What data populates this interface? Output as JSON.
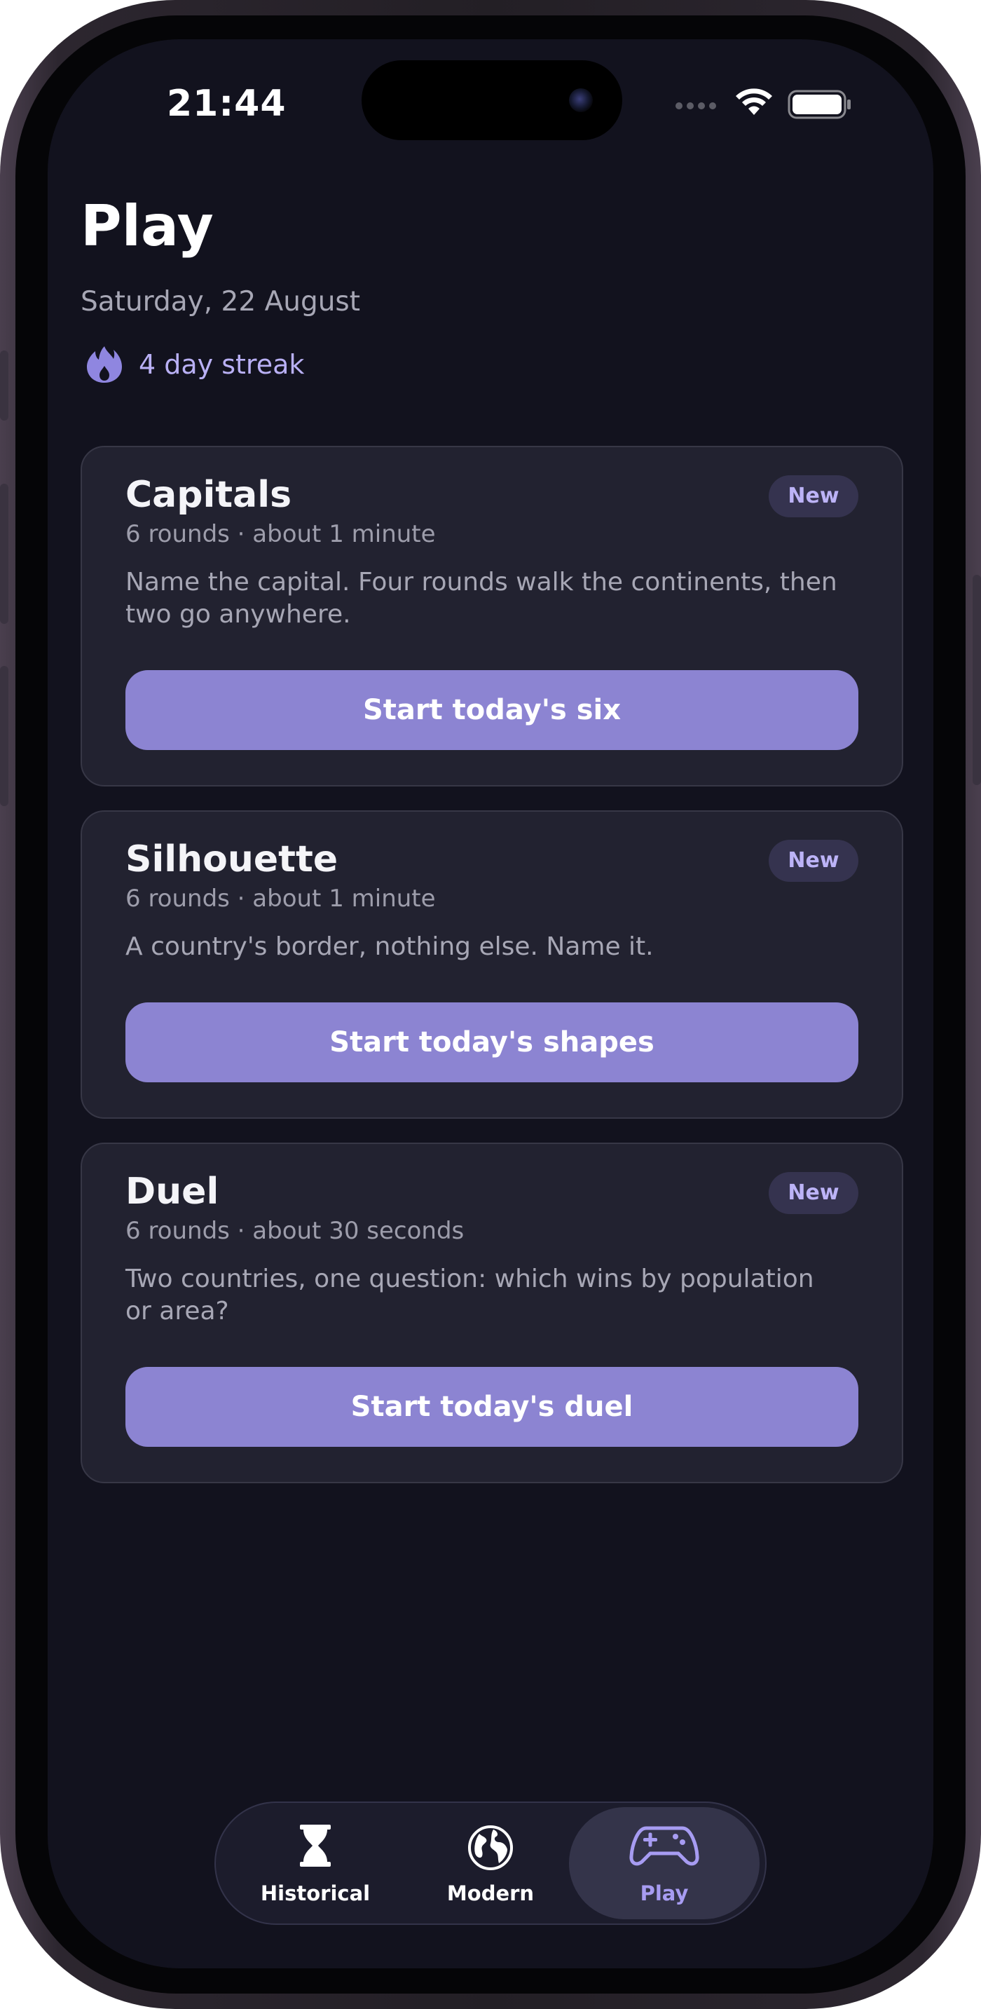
{
  "status_bar": {
    "time": "21:44"
  },
  "header": {
    "title": "Play",
    "date": "Saturday, 22 August",
    "streak": "4 day streak"
  },
  "cards": [
    {
      "title": "Capitals",
      "meta": "6 rounds · about 1 minute",
      "badge": "New",
      "description": "Name the capital. Four rounds walk the continents, then two go anywhere.",
      "button": "Start today's six"
    },
    {
      "title": "Silhouette",
      "meta": "6 rounds · about 1 minute",
      "badge": "New",
      "description": "A country's border, nothing else. Name it.",
      "button": "Start today's shapes"
    },
    {
      "title": "Duel",
      "meta": "6 rounds · about 30 seconds",
      "badge": "New",
      "description": "Two countries, one question: which wins by population or area?",
      "button": "Start today's duel"
    }
  ],
  "tabbar": {
    "tabs": [
      {
        "label": "Historical",
        "icon": "hourglass-icon"
      },
      {
        "label": "Modern",
        "icon": "globe-icon"
      },
      {
        "label": "Play",
        "icon": "gamepad-icon"
      }
    ],
    "active_index": 2
  },
  "colors": {
    "background": "#12121e",
    "card": "#222230",
    "accent": "#8c84d2",
    "accent_text": "#b9b0f5"
  }
}
